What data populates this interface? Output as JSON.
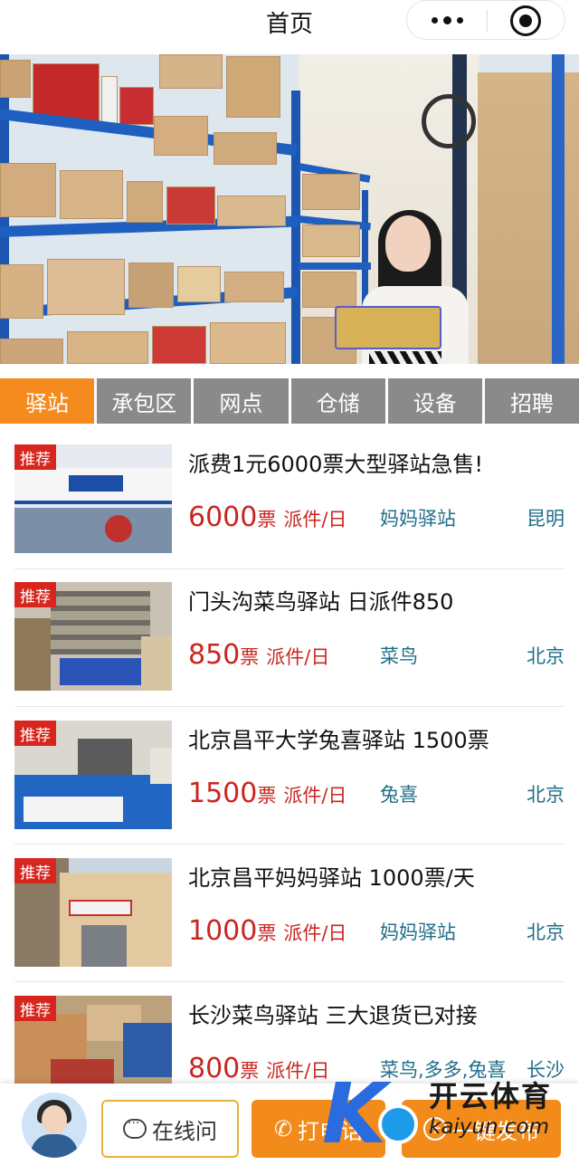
{
  "header": {
    "title": "首页"
  },
  "tabs": [
    {
      "label": "驿站",
      "active": true
    },
    {
      "label": "承包区",
      "active": false
    },
    {
      "label": "网点",
      "active": false
    },
    {
      "label": "仓储",
      "active": false
    },
    {
      "label": "设备",
      "active": false
    },
    {
      "label": "招聘",
      "active": false
    }
  ],
  "listings": [
    {
      "badge": "推荐",
      "title": "派费1元6000票大型驿站急售!",
      "count": "6000",
      "unit": "票",
      "per_day": "派件/日",
      "brand": "妈妈驿站",
      "city": "昆明"
    },
    {
      "badge": "推荐",
      "title": "门头沟菜鸟驿站 日派件850",
      "count": "850",
      "unit": "票",
      "per_day": "派件/日",
      "brand": "菜鸟",
      "city": "北京"
    },
    {
      "badge": "推荐",
      "title": "北京昌平大学兔喜驿站 1500票",
      "count": "1500",
      "unit": "票",
      "per_day": "派件/日",
      "brand": "兔喜",
      "city": "北京"
    },
    {
      "badge": "推荐",
      "title": "北京昌平妈妈驿站 1000票/天",
      "count": "1000",
      "unit": "票",
      "per_day": "派件/日",
      "brand": "妈妈驿站",
      "city": "北京"
    },
    {
      "badge": "推荐",
      "title": "长沙菜鸟驿站 三大退货已对接",
      "count": "800",
      "unit": "票",
      "per_day": "派件/日",
      "brand": "菜鸟,多多,兔喜",
      "city": "长沙"
    }
  ],
  "bottom_bar": {
    "ask_label": "在线问",
    "call_label": "打电话",
    "post_label": "一键发布"
  },
  "watermark": {
    "cn": "开云体育",
    "en": "kaiyun.com"
  },
  "colors": {
    "accent": "#f58a1f",
    "tab_inactive": "#8a8a8a",
    "price_red": "#c9261f",
    "badge_red": "#d6261e",
    "link_teal": "#1f6e8a"
  },
  "icons": {
    "more": "more-dots-icon",
    "close": "target-circle-icon",
    "ask": "chat-bubble-icon",
    "call": "phone-icon",
    "post": "plus-circle-icon"
  }
}
